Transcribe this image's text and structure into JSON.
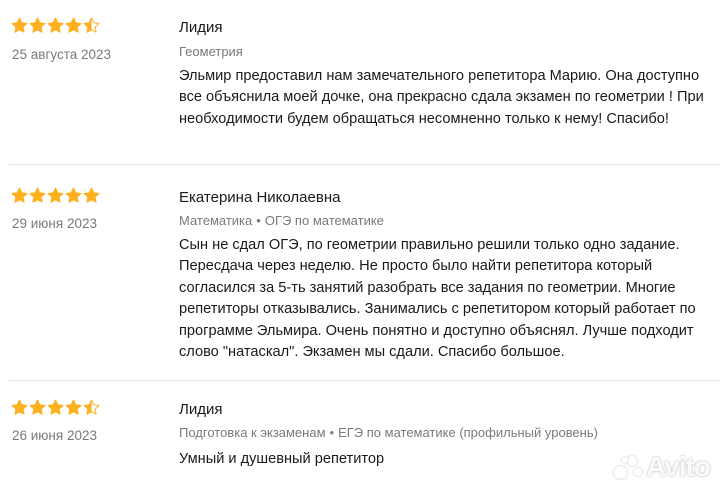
{
  "colors": {
    "star": "#ffb021",
    "text": "#1a1a1a",
    "muted": "#7a7a7a",
    "divider": "#e6e6e6"
  },
  "reviews": [
    {
      "rating": 4.5,
      "date": "25 августа 2023",
      "author": "Лидия",
      "tags": [
        "Геометрия"
      ],
      "text": "Эльмир предоставил нам замечательного репетитора Марию. Она доступно все объяснила моей дочке, она прекрасно сдала экзамен по геометрии ! При необходимости будем обращаться несомненно только к нему! Спасибо!"
    },
    {
      "rating": 5,
      "date": "29 июня 2023",
      "author": "Екатерина Николаевна",
      "tags": [
        "Математика",
        "ОГЭ по математике"
      ],
      "text": "Сын не сдал ОГЭ, по геометрии правильно решили только одно задание. Пересдача через неделю. Не просто было найти репетитора который согласился за 5-ть занятий разобрать все задания по геометрии. Многие репетиторы отказывались. Занимались с репетитором который работает по программе Эльмира. Очень понятно и доступно объяснял. Лучше подходит слово \"натаскал\". Экзамен мы сдали. Спасибо большое."
    },
    {
      "rating": 4.5,
      "date": "26 июня 2023",
      "author": "Лидия",
      "tags": [
        "Подготовка к экзаменам",
        "ЕГЭ по математике (профильный уровень)"
      ],
      "text": "Умный и душевный репетитор"
    }
  ],
  "tag_separator": "•",
  "watermark": {
    "text": "Avito"
  }
}
